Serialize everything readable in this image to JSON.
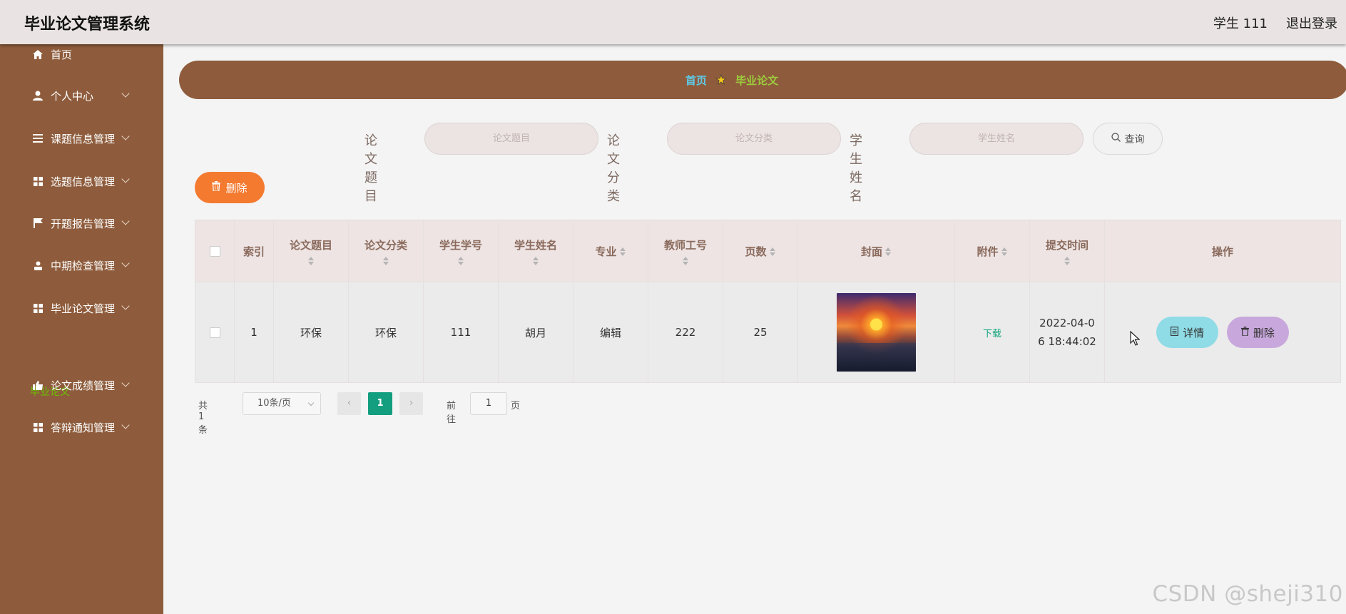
{
  "header": {
    "title": "毕业论文管理系统",
    "user_label": "学生 111",
    "logout_label": "退出登录"
  },
  "sidebar": {
    "items": [
      {
        "label": "首页",
        "icon": "home-icon"
      },
      {
        "label": "个人中心",
        "icon": "user-icon"
      },
      {
        "label": "课题信息管理",
        "icon": "list-icon"
      },
      {
        "label": "选题信息管理",
        "icon": "grid-icon"
      },
      {
        "label": "开题报告管理",
        "icon": "flag-icon"
      },
      {
        "label": "中期检查管理",
        "icon": "person-icon"
      },
      {
        "label": "毕业论文管理",
        "icon": "grid-icon"
      },
      {
        "label": "论文成绩管理",
        "icon": "thumb-icon"
      },
      {
        "label": "答辩通知管理",
        "icon": "grid-icon"
      }
    ],
    "active_sub": "毕业论文"
  },
  "breadcrumb": {
    "home": "首页",
    "current": "毕业论文"
  },
  "search": {
    "fields": [
      {
        "label": "论文题目",
        "placeholder": "论文题目"
      },
      {
        "label": "论文分类",
        "placeholder": "论文分类"
      },
      {
        "label": "学生姓名",
        "placeholder": "学生姓名"
      }
    ],
    "button": "查询"
  },
  "toolbar": {
    "delete_label": "删除"
  },
  "table": {
    "columns": [
      "索引",
      "论文题目",
      "论文分类",
      "学生学号",
      "学生姓名",
      "专业",
      "教师工号",
      "页数",
      "封面",
      "附件",
      "提交时间",
      "操作"
    ],
    "rows": [
      {
        "index": "1",
        "title": "环保",
        "category": "环保",
        "student_no": "111",
        "student_name": "胡月",
        "major": "编辑",
        "teacher_no": "222",
        "pages": "25",
        "attachment": "下载",
        "submit_time_line1": "2022-04-0",
        "submit_time_line2": "6 18:44:02",
        "detail_label": "详情",
        "delete_label": "删除"
      }
    ]
  },
  "pagination": {
    "total": "共 1 条",
    "page_size": "10条/页",
    "current_page": "1",
    "goto_label": "前往",
    "goto_value": "1",
    "page_suffix": "页"
  },
  "watermark": "CSDN @sheji310",
  "colors": {
    "sidebar": "#8e5c3c",
    "accent_orange": "#f47a30",
    "page_active": "#129e7f",
    "detail_button": "#8fdbe6",
    "delete_button": "#c8a8dc"
  }
}
